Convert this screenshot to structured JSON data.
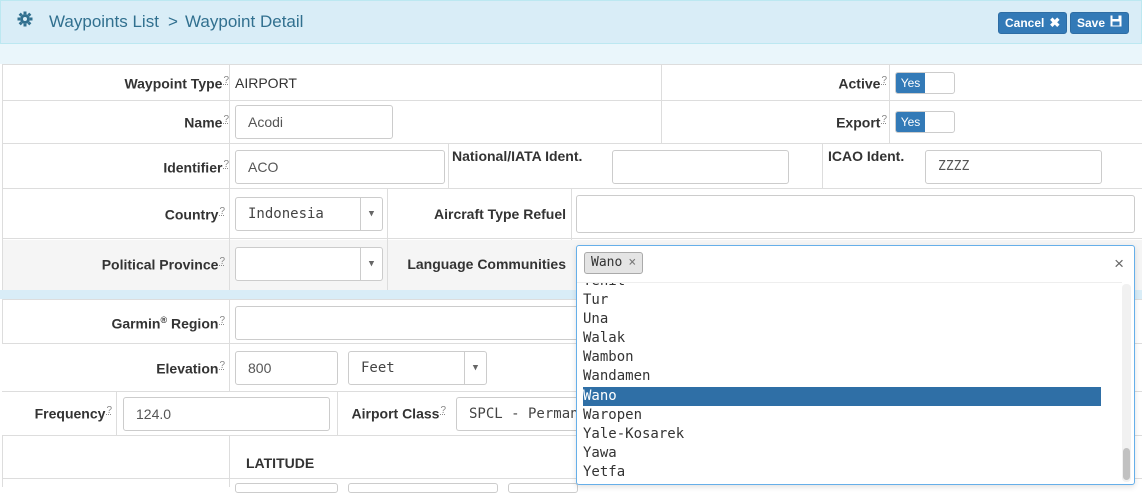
{
  "header": {
    "breadcrumb": [
      "Waypoints List",
      "Waypoint Detail"
    ],
    "separator": ">",
    "cancel_label": "Cancel",
    "save_label": "Save"
  },
  "help_mark": "?",
  "form": {
    "waypoint_type": {
      "label": "Waypoint Type",
      "value": "AIRPORT"
    },
    "active": {
      "label": "Active",
      "value": "Yes"
    },
    "name": {
      "label": "Name",
      "value": "Acodi"
    },
    "export": {
      "label": "Export",
      "value": "Yes"
    },
    "identifier": {
      "label": "Identifier",
      "value": "ACO"
    },
    "national_iata": {
      "label": "National/IATA Ident.",
      "value": ""
    },
    "icao": {
      "label": "ICAO Ident.",
      "value": "ZZZZ"
    },
    "country": {
      "label": "Country",
      "value": "Indonesia"
    },
    "aircraft_type_refuel": {
      "label": "Aircraft Type Refuel",
      "value": ""
    },
    "political_province": {
      "label": "Political Province",
      "value": ""
    },
    "language_communities": {
      "label": "Language Communities",
      "selected_tag": "Wano",
      "clear": "×",
      "tag_remove": "×"
    },
    "garmin_region": {
      "label_prefix": "Garmin",
      "label_mark": "®",
      "label_suffix": "Region",
      "value": ""
    },
    "elevation": {
      "label": "Elevation",
      "value": "800",
      "unit": "Feet"
    },
    "frequency": {
      "label": "Frequency",
      "value": "124.0"
    },
    "airport_class": {
      "label": "Airport Class",
      "value": "SPCL - Perman"
    },
    "latitude_header": "LATITUDE"
  },
  "dropdown": {
    "options": [
      "Tehit",
      "Tur",
      "Una",
      "Walak",
      "Wambon",
      "Wandamen",
      "Wano",
      "Waropen",
      "Yale-Kosarek",
      "Yawa",
      "Yetfa"
    ],
    "selected": "Wano"
  },
  "colors": {
    "accent": "#337ab7",
    "header_bg": "#d9edf7",
    "selected_option": "#2f6fa6"
  }
}
